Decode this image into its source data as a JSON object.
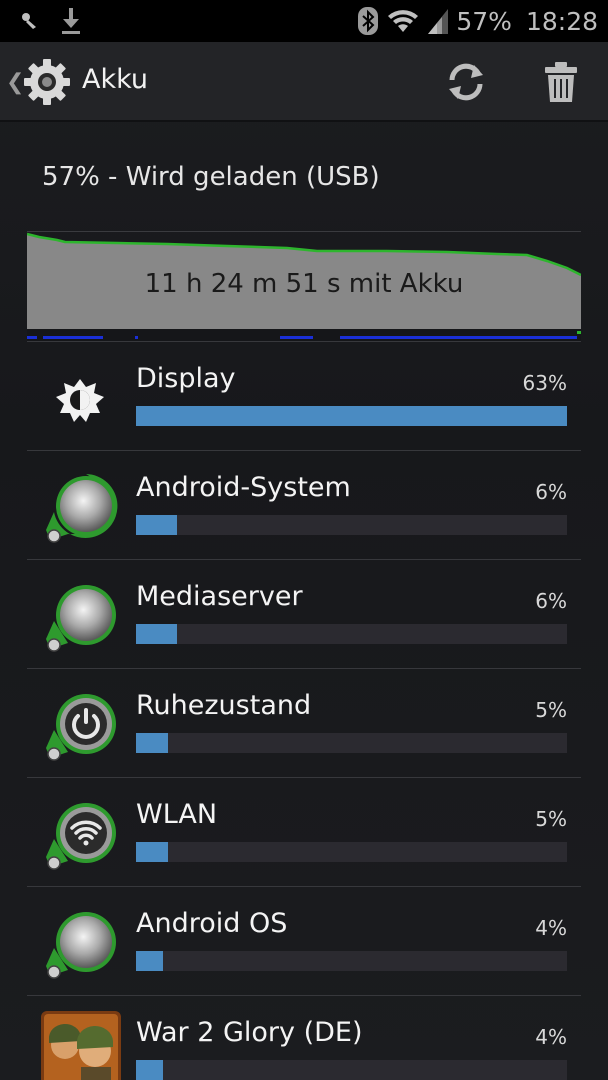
{
  "status_bar": {
    "battery_percent": "57%",
    "time": "18:28",
    "icons": [
      "notification-icon",
      "download-icon",
      "bluetooth-icon",
      "wifi-icon",
      "signal-icon"
    ]
  },
  "action_bar": {
    "title": "Akku",
    "icons": [
      "settings-gear-icon",
      "refresh-icon",
      "trash-icon"
    ]
  },
  "charge_status": "57% - Wird geladen (USB)",
  "graph": {
    "label": "11 h 24 m 51 s mit Akku",
    "colors": {
      "fill": "#888888",
      "line": "#2db52d",
      "signal": "#1a2fd6"
    }
  },
  "apps": [
    {
      "name": "Display",
      "percent": "63%",
      "level": 1.0,
      "icon": "brightness-icon"
    },
    {
      "name": "Android-System",
      "percent": "6%",
      "level": 0.095,
      "icon": "android-system-icon"
    },
    {
      "name": "Mediaserver",
      "percent": "6%",
      "level": 0.095,
      "icon": "mediaserver-icon"
    },
    {
      "name": "Ruhezustand",
      "percent": "5%",
      "level": 0.075,
      "icon": "power-icon"
    },
    {
      "name": "WLAN",
      "percent": "5%",
      "level": 0.075,
      "icon": "wifi-app-icon"
    },
    {
      "name": "Android OS",
      "percent": "4%",
      "level": 0.063,
      "icon": "android-os-icon"
    },
    {
      "name": "War 2 Glory (DE)",
      "percent": "4%",
      "level": 0.063,
      "icon": "game-icon"
    }
  ],
  "colors": {
    "bar": "#4a8bc2",
    "track": "#2b2a30"
  }
}
